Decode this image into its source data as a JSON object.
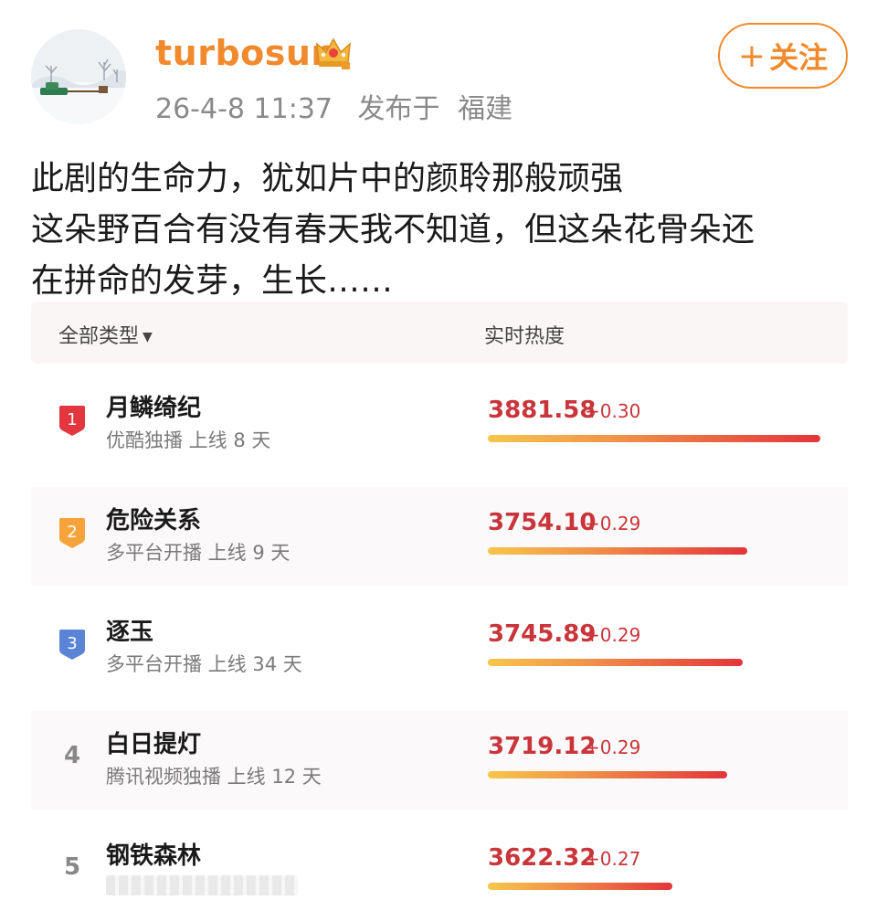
{
  "post": {
    "username": "turbosun",
    "timestamp": "26-4-8 11:37",
    "location_prefix": "发布于",
    "location": "福建",
    "follow_label": "关注",
    "follow_plus": "+",
    "text_lines": [
      "此剧的生命力，犹如片中的颜聆那般顽强",
      "这朵野百合有没有春天我不知道，但这朵花骨朵还",
      "在拼命的发芽，生长……"
    ]
  },
  "ranking": {
    "filter_label": "全部类型",
    "heat_header": "实时热度",
    "rows": [
      {
        "rank": "1",
        "title": "月鳞绮纪",
        "sub": "优酷独播 上线 8 天",
        "heat": "3881.58",
        "delta": "+0.30",
        "heat_value": 3881.58,
        "badge_color": "#e3363f"
      },
      {
        "rank": "2",
        "title": "危险关系",
        "sub": "多平台开播 上线 9 天",
        "heat": "3754.10",
        "delta": "+0.29",
        "heat_value": 3754.1,
        "badge_color": "#f5a33a"
      },
      {
        "rank": "3",
        "title": "逐玉",
        "sub": "多平台开播 上线 34 天",
        "heat": "3745.89",
        "delta": "+0.29",
        "heat_value": 3745.89,
        "badge_color": "#5b84d6"
      },
      {
        "rank": "4",
        "title": "白日提灯",
        "sub": "腾讯视频独播 上线 12 天",
        "heat": "3719.12",
        "delta": "+0.29",
        "heat_value": 3719.12,
        "badge_color": null
      },
      {
        "rank": "5",
        "title": "钢铁森林",
        "sub": "",
        "heat": "3622.32",
        "delta": "+0.27",
        "heat_value": 3622.32,
        "badge_color": null
      }
    ]
  },
  "colors": {
    "accent": "#f08a2c",
    "heat_red": "#c9353a",
    "bar_start": "#f7c64b",
    "bar_end": "#e3353a"
  }
}
